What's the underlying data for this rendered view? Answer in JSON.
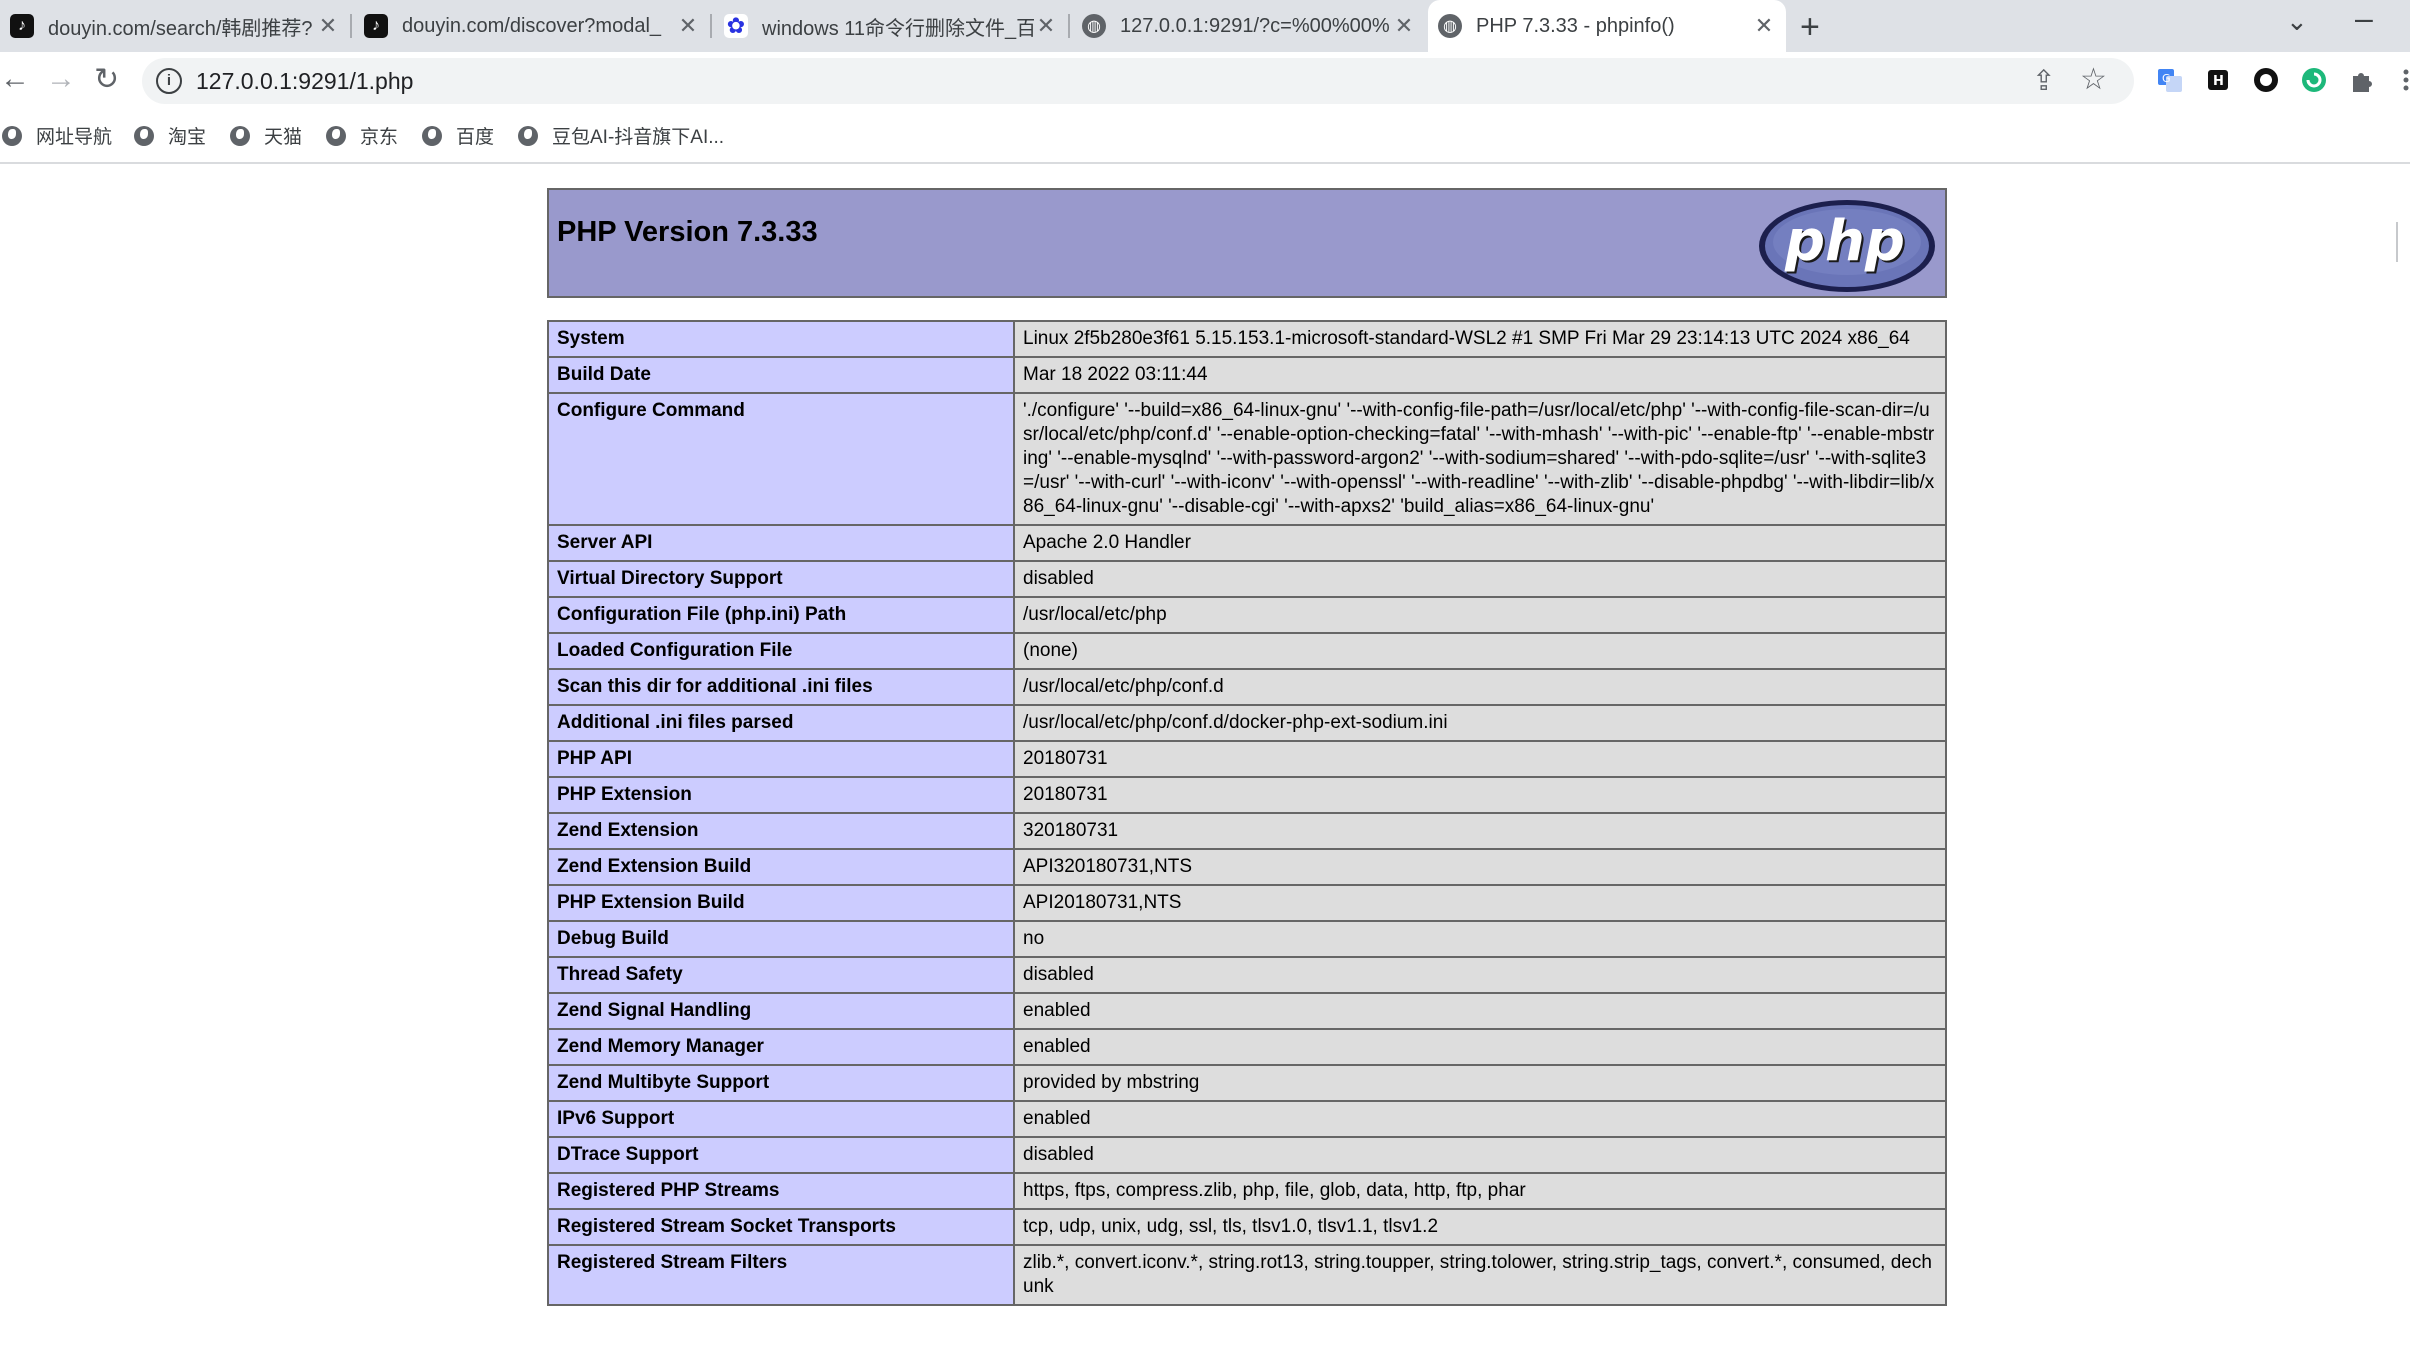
{
  "tabs": [
    {
      "title": "douyin.com/search/韩剧推荐?",
      "favicon": "tiktok-icon",
      "active": false
    },
    {
      "title": "douyin.com/discover?modal_",
      "favicon": "tiktok-icon",
      "active": false
    },
    {
      "title": "windows 11命令行删除文件_百",
      "favicon": "baidu-paw-icon",
      "active": false
    },
    {
      "title": "127.0.0.1:9291/?c=%00%00%",
      "favicon": "globe-icon",
      "active": false
    },
    {
      "title": "PHP 7.3.33 - phpinfo()",
      "favicon": "globe-icon",
      "active": true
    }
  ],
  "toolbar": {
    "url": "127.0.0.1:9291/1.php",
    "extensions": [
      "translate-icon",
      "h-extension-icon",
      "circle-extension-icon",
      "green-extension-icon",
      "puzzle-extensions-icon"
    ]
  },
  "bookmarks": [
    {
      "label": "网址导航"
    },
    {
      "label": "淘宝"
    },
    {
      "label": "天猫"
    },
    {
      "label": "京东"
    },
    {
      "label": "百度"
    },
    {
      "label": "豆包AI-抖音旗下AI..."
    }
  ],
  "php": {
    "version_title": "PHP Version 7.3.33",
    "logo_text": "php",
    "colors": {
      "header": "#9999cc",
      "key_cell": "#ccccff",
      "value_cell": "#dddddd"
    },
    "rows": [
      {
        "key": "System",
        "value": "Linux 2f5b280e3f61 5.15.153.1-microsoft-standard-WSL2 #1 SMP Fri Mar 29 23:14:13 UTC 2024 x86_64"
      },
      {
        "key": "Build Date",
        "value": "Mar 18 2022 03:11:44"
      },
      {
        "key": "Configure Command",
        "value": "'./configure' '--build=x86_64-linux-gnu' '--with-config-file-path=/usr/local/etc/php' '--with-config-file-scan-dir=/usr/local/etc/php/conf.d' '--enable-option-checking=fatal' '--with-mhash' '--with-pic' '--enable-ftp' '--enable-mbstring' '--enable-mysqlnd' '--with-password-argon2' '--with-sodium=shared' '--with-pdo-sqlite=/usr' '--with-sqlite3=/usr' '--with-curl' '--with-iconv' '--with-openssl' '--with-readline' '--with-zlib' '--disable-phpdbg' '--with-libdir=lib/x86_64-linux-gnu' '--disable-cgi' '--with-apxs2' 'build_alias=x86_64-linux-gnu'"
      },
      {
        "key": "Server API",
        "value": "Apache 2.0 Handler"
      },
      {
        "key": "Virtual Directory Support",
        "value": "disabled"
      },
      {
        "key": "Configuration File (php.ini) Path",
        "value": "/usr/local/etc/php"
      },
      {
        "key": "Loaded Configuration File",
        "value": "(none)"
      },
      {
        "key": "Scan this dir for additional .ini files",
        "value": "/usr/local/etc/php/conf.d"
      },
      {
        "key": "Additional .ini files parsed",
        "value": "/usr/local/etc/php/conf.d/docker-php-ext-sodium.ini"
      },
      {
        "key": "PHP API",
        "value": "20180731"
      },
      {
        "key": "PHP Extension",
        "value": "20180731"
      },
      {
        "key": "Zend Extension",
        "value": "320180731"
      },
      {
        "key": "Zend Extension Build",
        "value": "API320180731,NTS"
      },
      {
        "key": "PHP Extension Build",
        "value": "API20180731,NTS"
      },
      {
        "key": "Debug Build",
        "value": "no"
      },
      {
        "key": "Thread Safety",
        "value": "disabled"
      },
      {
        "key": "Zend Signal Handling",
        "value": "enabled"
      },
      {
        "key": "Zend Memory Manager",
        "value": "enabled"
      },
      {
        "key": "Zend Multibyte Support",
        "value": "provided by mbstring"
      },
      {
        "key": "IPv6 Support",
        "value": "enabled"
      },
      {
        "key": "DTrace Support",
        "value": "disabled"
      },
      {
        "key": "Registered PHP Streams",
        "value": "https, ftps, compress.zlib, php, file, glob, data, http, ftp, phar"
      },
      {
        "key": "Registered Stream Socket Transports",
        "value": "tcp, udp, unix, udg, ssl, tls, tlsv1.0, tlsv1.1, tlsv1.2"
      },
      {
        "key": "Registered Stream Filters",
        "value": "zlib.*, convert.iconv.*, string.rot13, string.toupper, string.tolower, string.strip_tags, convert.*, consumed, dechunk"
      }
    ]
  }
}
